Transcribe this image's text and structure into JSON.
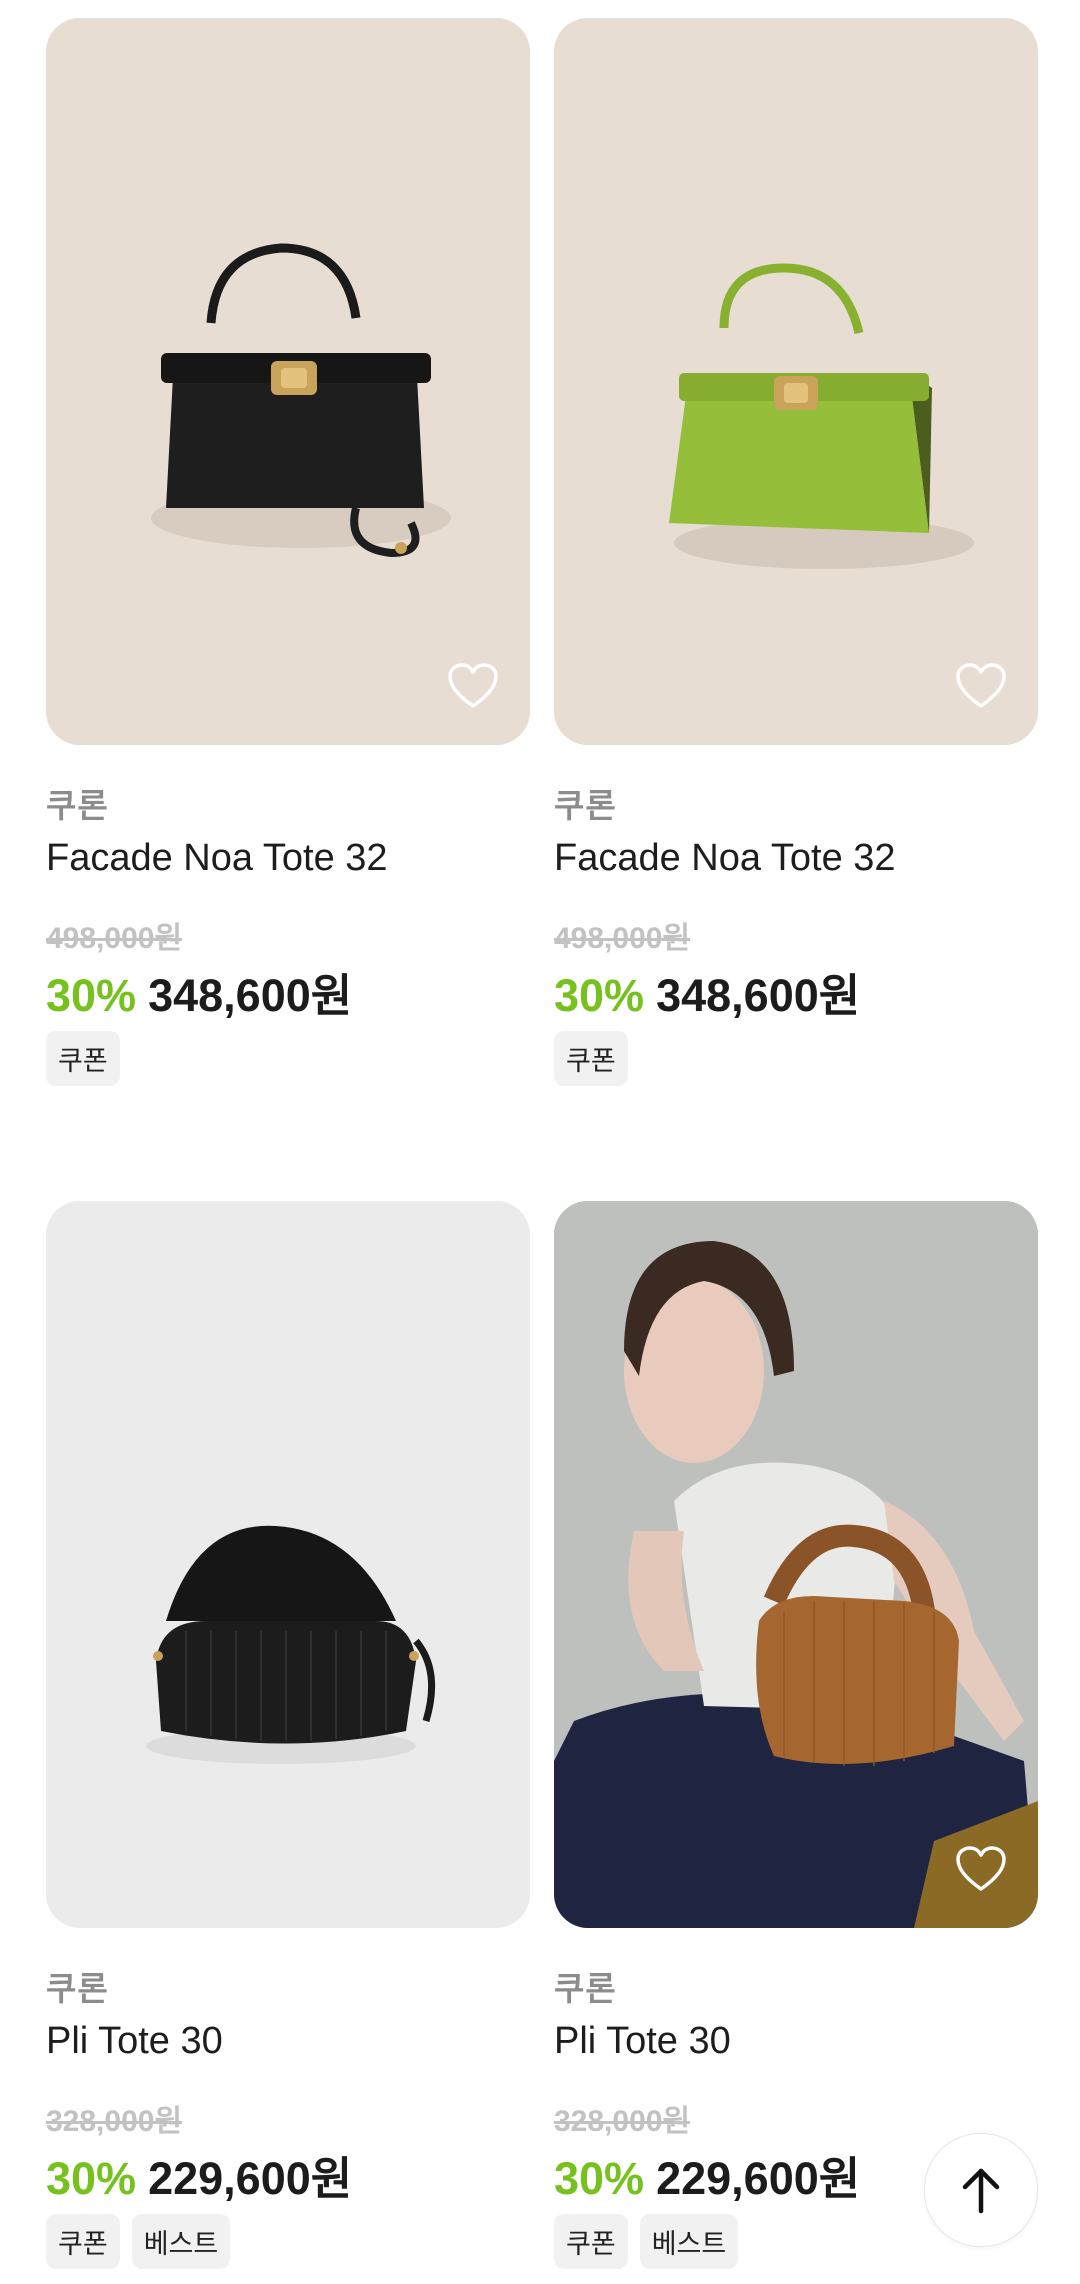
{
  "products": [
    {
      "brand": "쿠론",
      "name": "Facade Noa Tote 32",
      "original_price": "498,000원",
      "discount": "30%",
      "price": "348,600원",
      "tags": [
        "쿠폰"
      ],
      "image": "black-handbag",
      "bg_color": "#e6ddd4",
      "liked": false
    },
    {
      "brand": "쿠론",
      "name": "Facade Noa Tote 32",
      "original_price": "498,000원",
      "discount": "30%",
      "price": "348,600원",
      "tags": [
        "쿠폰"
      ],
      "image": "green-handbag",
      "bg_color": "#e6ddd4",
      "liked": false
    },
    {
      "brand": "쿠론",
      "name": "Pli Tote 30",
      "original_price": "328,000원",
      "discount": "30%",
      "price": "229,600원",
      "tags": [
        "쿠폰",
        "베스트"
      ],
      "image": "black-pleated-bag",
      "bg_color": "#ebebeb",
      "liked": false
    },
    {
      "brand": "쿠론",
      "name": "Pli Tote 30",
      "original_price": "328,000원",
      "discount": "30%",
      "price": "229,600원",
      "tags": [
        "쿠폰",
        "베스트"
      ],
      "image": "model-with-brown-bag",
      "bg_color": "#bfc1bd",
      "liked": false
    }
  ],
  "colors": {
    "discount": "#77c11f",
    "muted": "#8c8c8c"
  },
  "scroll_top_icon": "arrow-up-icon"
}
